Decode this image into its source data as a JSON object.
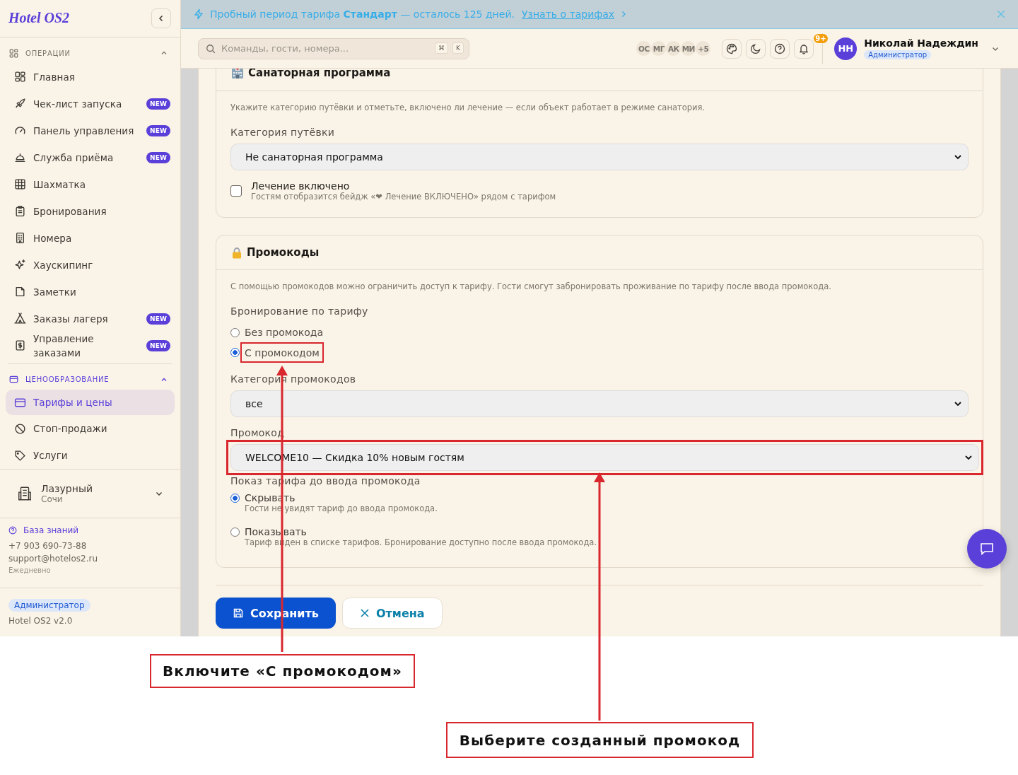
{
  "sidebar": {
    "logo": "Hotel OS2",
    "sections": [
      {
        "title": "ОПЕРАЦИИ",
        "expanded": true,
        "items": [
          {
            "label": "Главная",
            "selected": false
          },
          {
            "label": "Чек-лист запуска",
            "badge": "NEW",
            "selected": false
          },
          {
            "label": "Панель управления",
            "badge": "NEW",
            "selected": false
          },
          {
            "label": "Служба приёма",
            "badge": "NEW",
            "selected": false
          },
          {
            "label": "Шахматка",
            "selected": false
          },
          {
            "label": "Бронирования",
            "selected": false
          },
          {
            "label": "Номера",
            "selected": false
          },
          {
            "label": "Хаускипинг",
            "selected": false
          },
          {
            "label": "Заметки",
            "selected": false
          },
          {
            "label": "Заказы лагеря",
            "badge": "NEW",
            "selected": false
          },
          {
            "label": "Управление заказами",
            "badge": "NEW",
            "selected": false
          }
        ]
      },
      {
        "title": "ЦЕНООБРАЗОВАНИЕ",
        "expanded": true,
        "items": [
          {
            "label": "Тарифы и цены",
            "selected": true
          },
          {
            "label": "Стоп-продажи",
            "selected": false
          },
          {
            "label": "Услуги",
            "selected": false
          }
        ]
      }
    ],
    "property": {
      "name": "Лазурный",
      "city": "Сочи"
    },
    "support": {
      "link": "База знаний",
      "phone": "+7 903 690-73-88",
      "email": "support@hotelos2.ru",
      "hours": "Ежедневно"
    },
    "role": "Администратор",
    "version": "Hotel OS2 v2.0"
  },
  "banner": {
    "text": "Пробный период тарифа **Стандарт** — осталось 125 дней.",
    "link": "Узнать о тарифах"
  },
  "topbar": {
    "search": {
      "placeholder": "Команды, гости, номера..."
    },
    "shortcut": [
      "⌘",
      "K"
    ],
    "users": [
      "ОС",
      "МГ",
      "АК",
      "МИ",
      "+5"
    ],
    "notifications": "9+",
    "user": {
      "initials": "НН",
      "name": "Николай Надеждин",
      "role": "Администратор"
    }
  },
  "cards": [
    {
      "title": "Санаторная программа",
      "description": "Укажите категорию путёвки и отметьте, включено ли лечение — если объект работает в режиме санатория.",
      "fields": [
        {
          "kind": "select",
          "label": "Категория путёвки",
          "value": "Не санаторная программа"
        },
        {
          "kind": "checkbox",
          "label": "Лечение включено",
          "hint": "Гостям отобразится бейдж «❤ Лечение ВКЛЮЧЕНО» рядом с тарифом",
          "checked": false
        }
      ]
    },
    {
      "title": "Промокоды",
      "description": "С помощью промокодов можно ограничить доступ к тарифу. Гости смогут забронировать проживание по тарифу после ввода промокода.",
      "fields": [
        {
          "kind": "radio_group",
          "label": "Бронирование по тарифу",
          "options": [
            {
              "label": "Без промокода",
              "selected": false
            },
            {
              "label": "С промокодом",
              "selected": true,
              "highlighted": true
            }
          ]
        },
        {
          "kind": "select",
          "label": "Категория промокодов",
          "value": "все"
        },
        {
          "kind": "select",
          "label": "Промокод",
          "value": "WELCOME10 — Скидка 10% новым гостям",
          "highlighted": true
        },
        {
          "kind": "radio_group",
          "label": "Показ тарифа до ввода промокода",
          "options": [
            {
              "label": "Скрывать",
              "hint": "Гости не увидят тариф до ввода промокода.",
              "selected": true
            },
            {
              "label": "Показывать",
              "hint": "Тариф виден в списке тарифов. Бронирование доступно после ввода промокода.",
              "selected": false
            }
          ]
        }
      ]
    }
  ],
  "actions": [
    {
      "kind": "primary",
      "label": "Сохранить"
    },
    {
      "kind": "secondary",
      "label": "Отмена"
    }
  ],
  "annotations": [
    {
      "text": "Включите «С промокодом»"
    },
    {
      "text": "Выберите созданный промокод"
    }
  ]
}
